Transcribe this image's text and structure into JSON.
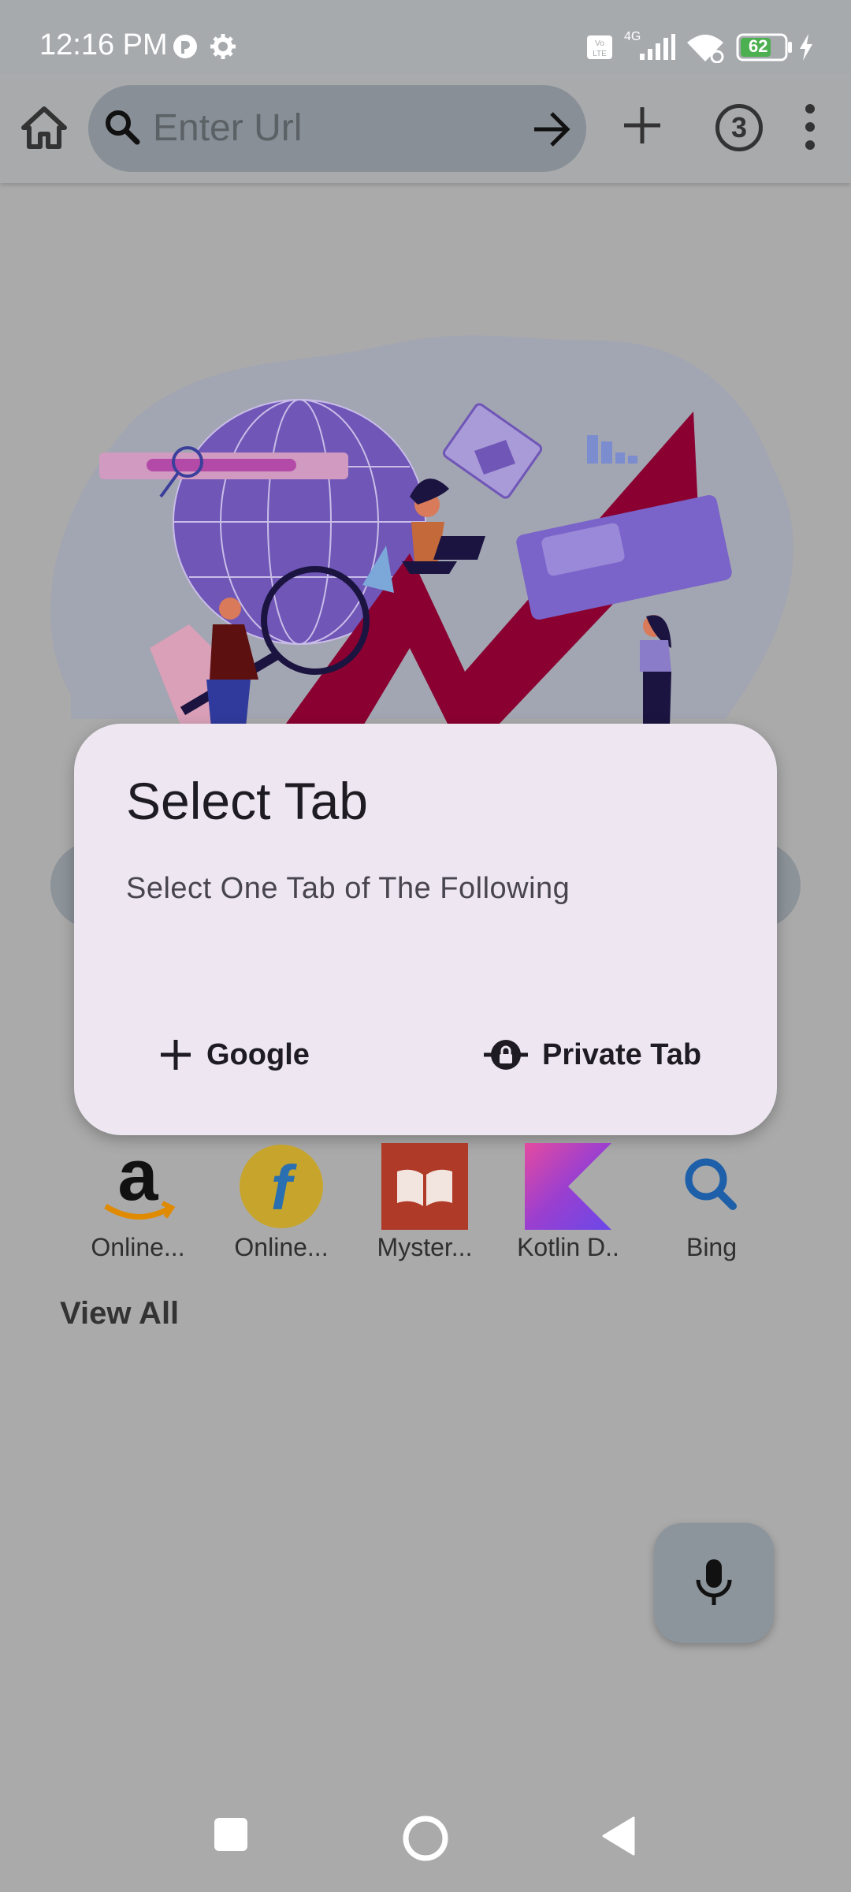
{
  "status_bar": {
    "time": "12:16 PM",
    "network": "4G",
    "volte": "Vo LTE",
    "battery": "62"
  },
  "app_bar": {
    "url_placeholder": "Enter Url",
    "tab_count": "3",
    "icons": [
      "home-icon",
      "search-icon",
      "arrow-right-icon",
      "plus-icon",
      "more-vert-icon"
    ]
  },
  "dialog": {
    "title": "Select Tab",
    "message": "Select One Tab of The Following",
    "buttons": [
      {
        "label": "Google",
        "icon": "plus-icon"
      },
      {
        "label": "Private Tab",
        "icon": "lock-icon"
      }
    ]
  },
  "shortcuts": [
    {
      "label": "Online...",
      "icon": "amazon-icon"
    },
    {
      "label": "Online...",
      "icon": "flipkart-icon"
    },
    {
      "label": "Myster...",
      "icon": "book-icon"
    },
    {
      "label": "Kotlin D..",
      "icon": "kotlin-icon"
    },
    {
      "label": "Bing",
      "icon": "bing-search-icon"
    }
  ],
  "view_all_label": "View All",
  "fab": {
    "icon": "mic-icon"
  },
  "nav_bar": {
    "icons": [
      "recents-square-icon",
      "home-circle-icon",
      "back-triangle-icon"
    ]
  },
  "colors": {
    "dialog_bg": "#eee7f2",
    "scrim_bg": "#aaaaaa",
    "url_bar": "#888f96",
    "illustration_red": "#8a0030",
    "illustration_purple": "#6f56b7"
  }
}
